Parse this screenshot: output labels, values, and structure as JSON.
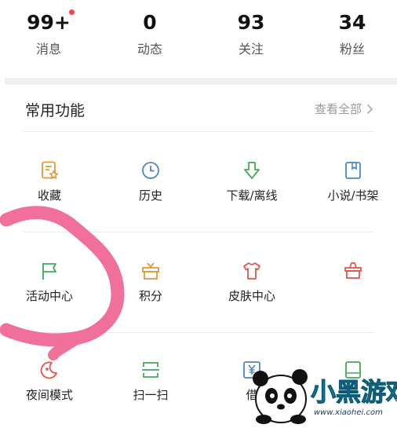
{
  "stats": [
    {
      "value": "99+",
      "label": "消息"
    },
    {
      "value": "0",
      "label": "动态"
    },
    {
      "value": "93",
      "label": "关注"
    },
    {
      "value": "34",
      "label": "粉丝"
    }
  ],
  "colors": {
    "badge": "#e74c4c",
    "icon_orange": "#e09a3c",
    "icon_blue": "#4a86c8",
    "icon_green": "#3faa5a",
    "icon_red": "#e0564e",
    "annotation": "#f0709a"
  },
  "section": {
    "title": "常用功能",
    "view_all": "查看全部"
  },
  "rows": [
    [
      {
        "icon": "favorites-icon",
        "label": "收藏"
      },
      {
        "icon": "history-clock-icon",
        "label": "历史"
      },
      {
        "icon": "download-arrow-icon",
        "label": "下载/离线"
      },
      {
        "icon": "bookmark-book-icon",
        "label": "小说/书架"
      }
    ],
    [
      {
        "icon": "flag-icon",
        "label": "活动中心"
      },
      {
        "icon": "gift-box-icon",
        "label": "积分"
      },
      {
        "icon": "tshirt-icon",
        "label": "皮肤中心"
      },
      {
        "icon": "shop-basket-icon",
        "label": ""
      }
    ],
    [
      {
        "icon": "moon-icon",
        "label": "夜间模式"
      },
      {
        "icon": "scan-icon",
        "label": "扫一扫"
      },
      {
        "icon": "yuan-loan-icon",
        "label": "借"
      },
      {
        "icon": "box-icon",
        "label": ""
      }
    ]
  ],
  "watermark": {
    "text": "小黑游戏",
    "url": "www.xiaohei.com"
  }
}
